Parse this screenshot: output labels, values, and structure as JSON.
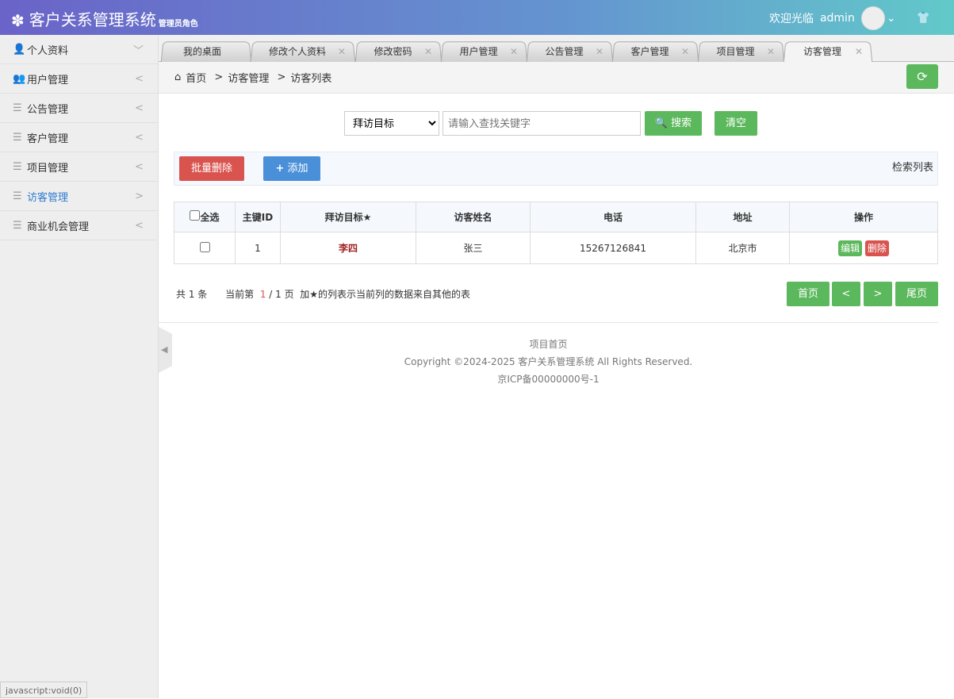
{
  "header": {
    "title": "客户关系管理系统",
    "role": "管理员角色",
    "welcome": "欢迎光临",
    "user": "admin"
  },
  "sidebar": [
    {
      "label": "个人资料",
      "icon": "user-icon",
      "ch": "﹀"
    },
    {
      "label": "用户管理",
      "icon": "users-icon",
      "ch": "<"
    },
    {
      "label": "公告管理",
      "icon": "list-icon",
      "ch": "<"
    },
    {
      "label": "客户管理",
      "icon": "list-icon",
      "ch": "<"
    },
    {
      "label": "项目管理",
      "icon": "list-icon",
      "ch": "<"
    },
    {
      "label": "访客管理",
      "icon": "list-icon",
      "ch": ">"
    },
    {
      "label": "商业机会管理",
      "icon": "list-icon",
      "ch": "<"
    }
  ],
  "tabs": [
    "我的桌面",
    "修改个人资料",
    "修改密码",
    "用户管理",
    "公告管理",
    "客户管理",
    "项目管理",
    "访客管理"
  ],
  "breadcrumb": [
    "首页",
    "访客管理",
    "访客列表"
  ],
  "search": {
    "select": "拜访目标",
    "placeholder": "请输入查找关键字",
    "search": "搜索",
    "clear": "清空"
  },
  "toolbar": {
    "batch_delete": "批量删除",
    "add": "添加",
    "title": "检索列表"
  },
  "table": {
    "headers": [
      "全选",
      "主键ID",
      "拜访目标★",
      "访客姓名",
      "电话",
      "地址",
      "操作"
    ],
    "rows": [
      {
        "id": "1",
        "target": "李四",
        "name": "张三",
        "phone": "15267126841",
        "address": "北京市",
        "edit": "编辑",
        "delete": "删除"
      }
    ]
  },
  "pager": {
    "total": "共 1 条",
    "current_prefix": "当前第",
    "current": "1",
    "pages": "/ 1 页",
    "note": "加★的列表示当前列的数据来自其他的表",
    "first": "首页",
    "prev": "<",
    "next": ">",
    "last": "尾页"
  },
  "footer": {
    "link": "项目首页",
    "copyright": "Copyright ©2024-2025 客户关系管理系统 All Rights Reserved.",
    "icp": "京ICP备00000000号-1"
  },
  "status": "javascript:void(0)"
}
